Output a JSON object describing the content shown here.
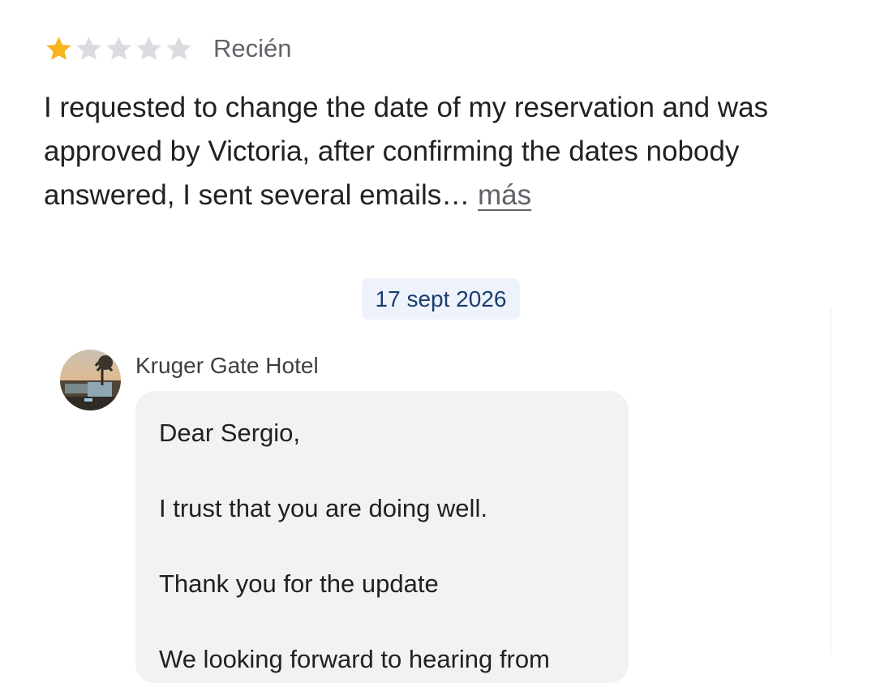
{
  "review": {
    "rating": 1,
    "max_rating": 5,
    "colors": {
      "star_filled": "#f6b51e",
      "star_empty": "#dadce0"
    },
    "time_ago": "Recién",
    "text": "I requested to change the date of my reservation and was approved by Victoria, after confirming the dates nobody answered, I sent several emails…",
    "more_label": "más"
  },
  "date_chip": "17 sept 2026",
  "owner_reply": {
    "author": "Kruger Gate Hotel",
    "lines": [
      "Dear Sergio,",
      "I trust that you are doing well.",
      "Thank you for the update",
      "We looking forward to hearing from"
    ]
  }
}
